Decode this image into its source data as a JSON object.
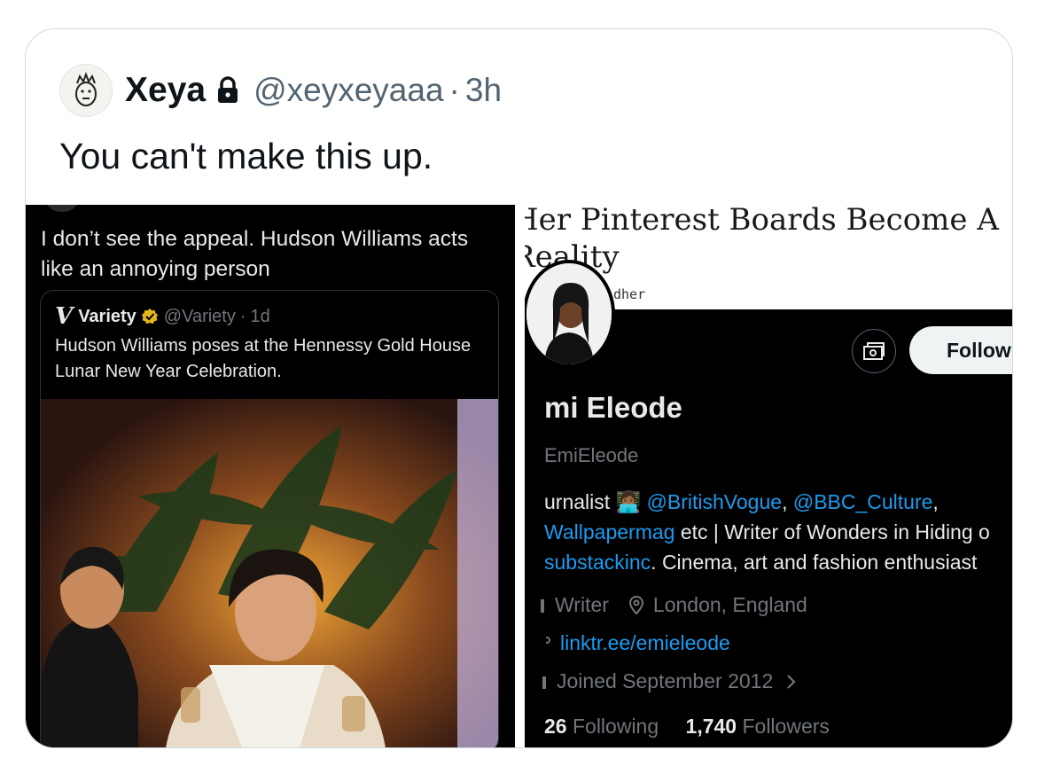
{
  "tweet": {
    "author_name": "Xeya",
    "author_handle": "@xeyxeyaaa",
    "separator": "·",
    "time": "3h",
    "text": "You can't make this up."
  },
  "left_screenshot": {
    "reply_text": "I don’t see the appeal. Hudson Williams acts like an annoying person",
    "quote": {
      "logo": "V",
      "name": "Variety",
      "handle": "@Variety",
      "separator": "·",
      "time": "1d",
      "text": "Hudson Williams poses at the Hennessy Gold House Lunar New Year Celebration."
    }
  },
  "right_screenshot": {
    "banner_title_line1": "Her Pinterest Boards Become A",
    "banner_title_line2": "Reality",
    "banner_byline": "dher",
    "follow_label": "Follow",
    "profile_name": "mi Eleode",
    "profile_handle": "EmiEleode",
    "bio": {
      "line1_prefix": "urnalist 👩🏾‍💻 ",
      "line1_link1": "@BritishVogue",
      "line1_sep": ", ",
      "line1_link2": "@BBC_Culture",
      "line1_suffix": ",",
      "line2_link": "Wallpapermag",
      "line2_text": " etc | Writer of Wonders in Hiding o",
      "line3_link": "substackinc",
      "line3_text": ". Cinema, art and fashion enthusiast"
    },
    "occupation": "Writer",
    "location": "London, England",
    "url": "linktr.ee/emieleode",
    "joined": "Joined September 2012",
    "following_count": "26",
    "following_label": "Following",
    "followers_count": "1,740",
    "followers_label": "Followers"
  }
}
